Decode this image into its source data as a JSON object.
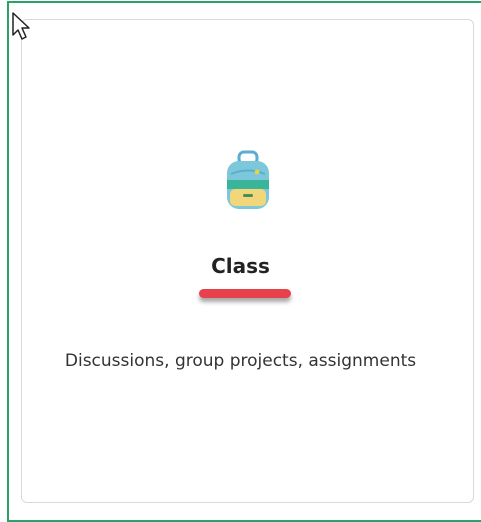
{
  "card": {
    "title": "Class",
    "description": "Discussions, group projects, assignments",
    "icon": "backpack-icon"
  },
  "colors": {
    "frame_border": "#2aa26a",
    "underline": "#e8414b",
    "backpack_body": "#7cc7d9",
    "backpack_pocket": "#f2d67a",
    "backpack_accent": "#3bb59a"
  }
}
